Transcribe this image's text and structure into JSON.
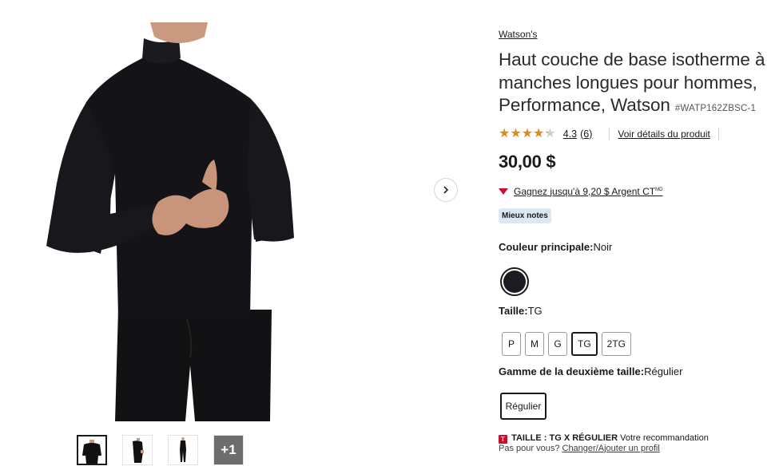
{
  "gallery": {
    "main_image_alt": "product-photo",
    "thumbnails": [
      {
        "kind": "torso"
      },
      {
        "kind": "side"
      },
      {
        "kind": "full"
      }
    ],
    "more_label": "+1"
  },
  "product": {
    "brand": "Watson's",
    "title": "Haut couche de base isotherme à manches longues pour hommes, Performance, Watson",
    "sku": "#WATP162ZBSC-1",
    "rating_value": "4.3",
    "rating_count": "(6)",
    "rating_stars": 4.3,
    "details_link": "Voir détails du produit",
    "price": "30,00 $",
    "ct_money": "Gagnez jusqu'à 9,20 $ Argent CT",
    "ct_sup": "MD",
    "badge": "Mieux notes"
  },
  "options": {
    "color_label": "Couleur principale:",
    "color_value": "Noir",
    "size_label": "Taille:",
    "size_value": "TG",
    "sizes": [
      "P",
      "M",
      "G",
      "TG",
      "2TG"
    ],
    "selected_size": "TG",
    "range_label": "Gamme de la deuxième taille:",
    "range_value": "Régulier",
    "range_button": "Régulier"
  },
  "recommendation": {
    "icon_letter": "T",
    "size_text": "TAILLE : TG X RÉGULIER",
    "suffix": "Votre recommandation",
    "question": "Pas pour vous?",
    "link": "Changer/Ajouter un profil"
  },
  "colors": {
    "ct_red": "#c8102e",
    "star": "#e08a1e",
    "badge_bg": "#dde8f5",
    "swatch": "#1b1b22"
  }
}
